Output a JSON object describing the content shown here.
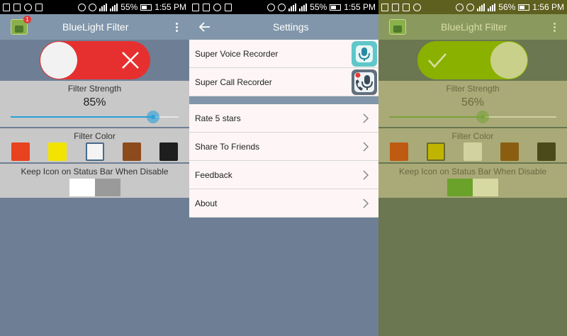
{
  "status_bar": [
    {
      "battery": "55%",
      "time": "1:55 PM"
    },
    {
      "battery": "55%",
      "time": "1:55 PM"
    },
    {
      "battery": "56%",
      "time": "1:56 PM"
    }
  ],
  "screen1": {
    "title": "BlueLight Filter",
    "badge": "1",
    "filter_enabled": false,
    "strength_label": "Filter Strength",
    "strength_value": "85%",
    "strength_fraction": 0.85,
    "color_label": "Filter Color",
    "colors": [
      "#e8421e",
      "#f2e400",
      "#f4f4f4",
      "#8d4a1c",
      "#1e1e1e"
    ],
    "selected_color": 2,
    "keep_label": "Keep Icon on Status Bar When Disable",
    "keep_enabled": false
  },
  "screen2": {
    "title": "Settings",
    "apps": [
      {
        "label": "Super Voice Recorder",
        "icon": "microphone-icon"
      },
      {
        "label": "Super Call Recorder",
        "icon": "call-recorder-icon"
      }
    ],
    "items": [
      {
        "label": "Rate 5 stars"
      },
      {
        "label": "Share To Friends"
      },
      {
        "label": "Feedback"
      },
      {
        "label": "About"
      }
    ]
  },
  "screen3": {
    "title": "BlueLight Filter",
    "filter_enabled": true,
    "strength_label": "Filter Strength",
    "strength_value": "56%",
    "strength_fraction": 0.56,
    "color_label": "Filter Color",
    "colors": [
      "#bf5a12",
      "#c0b400",
      "#d2d2a0",
      "#8a5e10",
      "#4a4a1a"
    ],
    "selected_color": 1,
    "keep_label": "Keep Icon on Status Bar When Disable",
    "keep_enabled": true
  }
}
